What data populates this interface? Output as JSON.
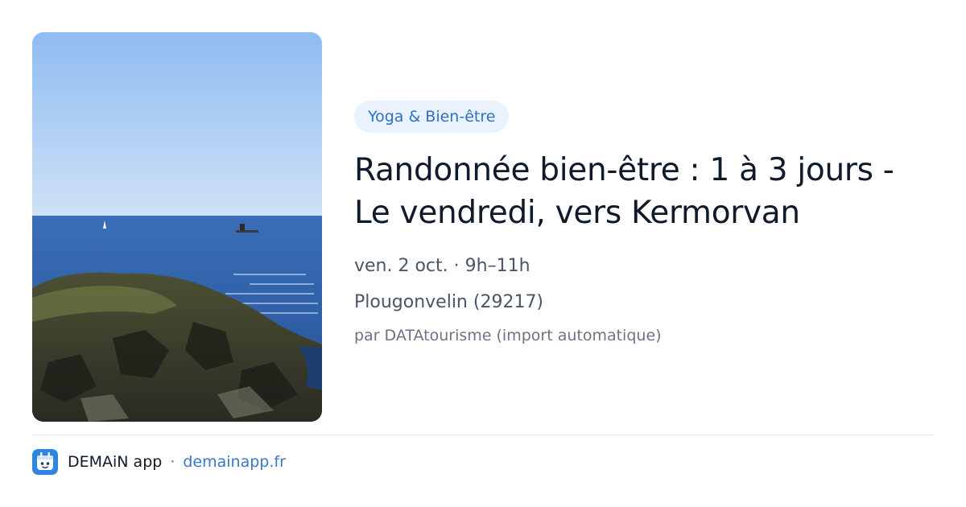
{
  "event": {
    "image_alt": "Côte rocheuse face à la mer",
    "category_tag": "Yoga & Bien-être",
    "title": "Randonnée bien-être : 1 à 3 jours - Le vendredi, vers Kermorvan",
    "datetime": "ven. 2 oct. · 9h–11h",
    "location": "Plougonvelin (29217)",
    "source": "par DATAtourisme (import automatique)"
  },
  "footer": {
    "logo_icon": "demain-app-logo-icon",
    "brand": "DEMAiN app",
    "separator": "·",
    "url": "demainapp.fr"
  },
  "colors": {
    "tag_bg": "#eaf3fd",
    "tag_text": "#2f6fc4",
    "title": "#0f1a2a",
    "link": "#3a78c9",
    "logo_bg": "#2f86e0"
  }
}
